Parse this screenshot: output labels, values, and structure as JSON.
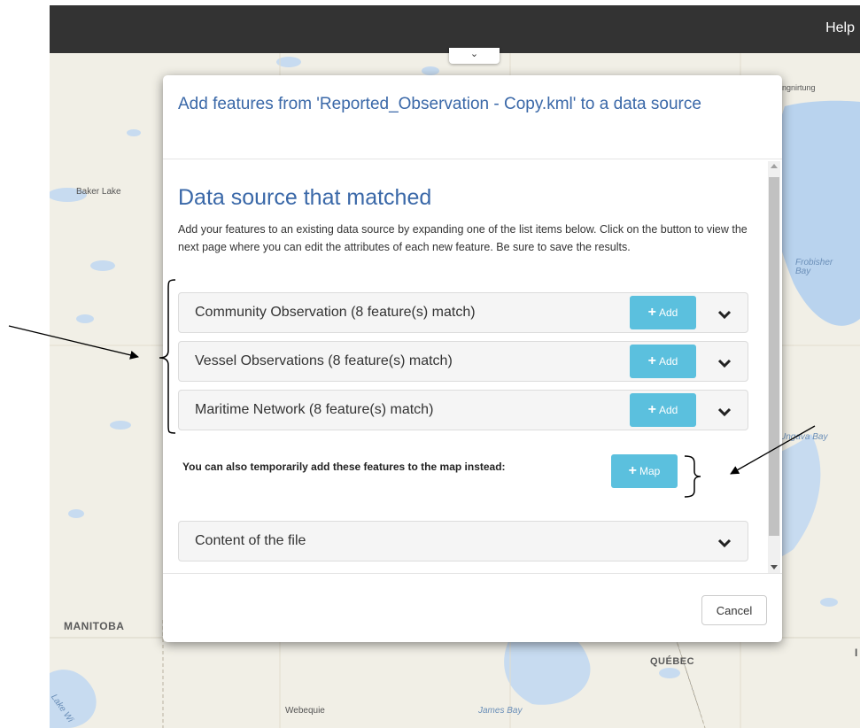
{
  "topbar": {
    "help_label": "Help"
  },
  "collapse_tab": {
    "icon": "chevron-down-icon",
    "glyph": "⌄"
  },
  "map": {
    "labels": {
      "baker_lake": "Baker Lake",
      "pangnirtung": "Pangnirtung",
      "frobisher_bay": "Frobisher Bay",
      "ungava_bay": "Ungava Bay",
      "manitoba": "MANITOBA",
      "quebec": "QUÉBEC",
      "webequie": "Webequie",
      "james_bay": "James Bay",
      "lake_winnipeg": "Lake Wi",
      "edge_letter": "I"
    }
  },
  "dialog": {
    "title": "Add features from 'Reported_Observation - Copy.kml' to a data source",
    "section_title": "Data source that matched",
    "description": "Add your features to an existing data source by expanding one of the list items below. Click on the button to view the next page where you can edit the attributes of each new feature. Be sure to save the results.",
    "sources": [
      {
        "label": "Community Observation (8 feature(s) match)",
        "add_label": "Add"
      },
      {
        "label": "Vessel Observations (8 feature(s) match)",
        "add_label": "Add"
      },
      {
        "label": "Maritime Network (8 feature(s) match)",
        "add_label": "Add"
      }
    ],
    "also_text": "You can also temporarily add these features to the map instead:",
    "map_button_label": "Map",
    "content_section_label": "Content of the file",
    "cancel_label": "Cancel"
  },
  "colors": {
    "accent_blue": "#3a68a8",
    "button_info": "#5bc0de",
    "topbar": "#333333"
  }
}
